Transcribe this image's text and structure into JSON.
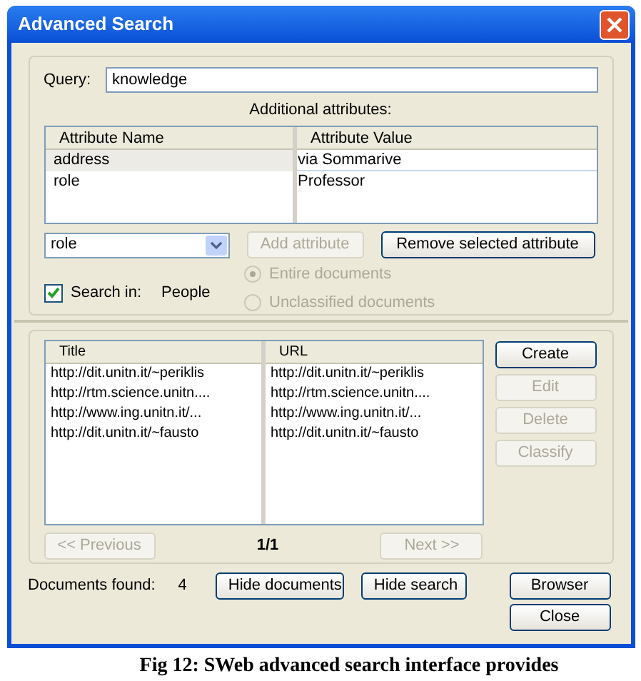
{
  "window": {
    "title": "Advanced Search"
  },
  "query": {
    "label": "Query:",
    "value": "knowledge"
  },
  "attributes": {
    "heading": "Additional attributes:",
    "columns": [
      "Attribute Name",
      "Attribute Value"
    ],
    "rows": [
      {
        "name": "address",
        "value": "via Sommarive",
        "selected": true
      },
      {
        "name": "role",
        "value": "Professor",
        "selected": false
      }
    ]
  },
  "attribute_select": {
    "value": "role"
  },
  "attribute_buttons": [
    {
      "label": "Add attribute",
      "disabled": true
    },
    {
      "label": "Remove selected attribute",
      "disabled": false
    }
  ],
  "search_in": {
    "label": "Search in:",
    "checked": true,
    "value": "People"
  },
  "scope_options": [
    {
      "label": "Entire documents",
      "selected": true,
      "disabled": true
    },
    {
      "label": "Unclassified documents",
      "selected": false,
      "disabled": true
    }
  ],
  "documents": {
    "columns": [
      "Title",
      "URL"
    ],
    "rows": [
      {
        "title": "http://dit.unitn.it/~periklis",
        "url": "http://dit.unitn.it/~periklis"
      },
      {
        "title": "http://rtm.science.unitn....",
        "url": "http://rtm.science.unitn...."
      },
      {
        "title": "http://www.ing.unitn.it/...",
        "url": "http://www.ing.unitn.it/..."
      },
      {
        "title": "http://dit.unitn.it/~fausto",
        "url": "http://dit.unitn.it/~fausto"
      }
    ]
  },
  "document_buttons": [
    {
      "label": "Create",
      "disabled": false
    },
    {
      "label": "Edit",
      "disabled": true
    },
    {
      "label": "Delete",
      "disabled": true
    },
    {
      "label": "Classify",
      "disabled": true
    }
  ],
  "pager": {
    "previous": {
      "label": "<< Previous",
      "disabled": true
    },
    "page": "1/1",
    "next": {
      "label": "Next >>",
      "disabled": true
    }
  },
  "footer": {
    "found_label": "Documents found:",
    "found_count": "4",
    "buttons": [
      {
        "label": "Hide documents",
        "disabled": false
      },
      {
        "label": "Hide search",
        "disabled": false
      },
      {
        "label": "Browser",
        "disabled": false
      },
      {
        "label": "Close",
        "disabled": false
      }
    ]
  },
  "caption": "Fig 12: SWeb advanced search interface provides"
}
